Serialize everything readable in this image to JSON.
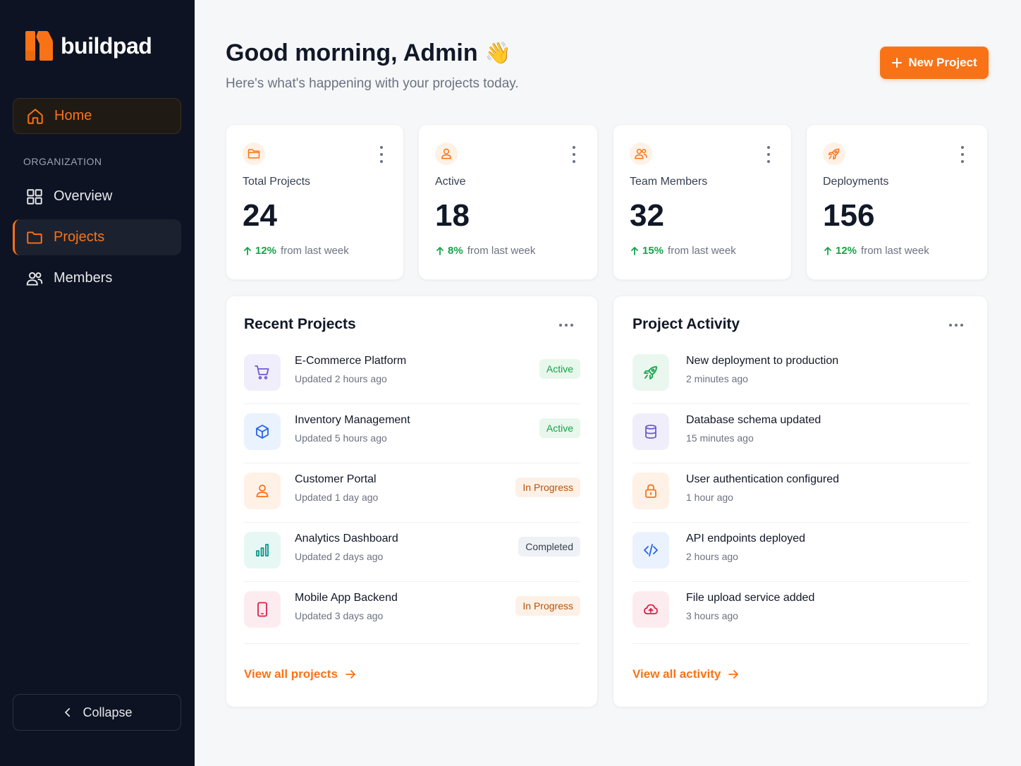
{
  "brand": {
    "name": "buildpad",
    "accent": "#f97316"
  },
  "sidebar": {
    "home_label": "Home",
    "section_label": "ORGANIZATION",
    "items": [
      {
        "label": "Overview",
        "icon": "grid-icon"
      },
      {
        "label": "Projects",
        "icon": "folder-icon"
      },
      {
        "label": "Members",
        "icon": "users-icon"
      }
    ],
    "collapse_label": "Collapse"
  },
  "header": {
    "greeting": "Good morning, Admin",
    "wave": "👋",
    "subtitle": "Here's what's happening with your projects today.",
    "new_project_label": "New Project"
  },
  "stats": [
    {
      "label": "Total Projects",
      "value": "24",
      "change": "12%",
      "change_text": "from last week",
      "icon": "folder-icon"
    },
    {
      "label": "Active",
      "value": "18",
      "change": "8%",
      "change_text": "from last week",
      "icon": "user-icon"
    },
    {
      "label": "Team Members",
      "value": "32",
      "change": "15%",
      "change_text": "from last week",
      "icon": "users-icon"
    },
    {
      "label": "Deployments",
      "value": "156",
      "change": "12%",
      "change_text": "from last week",
      "icon": "rocket-icon"
    }
  ],
  "recent_projects": {
    "title": "Recent Projects",
    "items": [
      {
        "name": "E-Commerce Platform",
        "updated": "Updated 2 hours ago",
        "status": "Active",
        "icon": "cart-icon",
        "icon_color": "#6d5bd0",
        "icon_bg": "#f1eefb"
      },
      {
        "name": "Inventory Management",
        "updated": "Updated 5 hours ago",
        "status": "Active",
        "icon": "box-icon",
        "icon_color": "#2563eb",
        "icon_bg": "#eaf2fd"
      },
      {
        "name": "Customer Portal",
        "updated": "Updated 1 day ago",
        "status": "In Progress",
        "icon": "user-icon",
        "icon_color": "#f97316",
        "icon_bg": "#fff1e6"
      },
      {
        "name": "Analytics Dashboard",
        "updated": "Updated 2 days ago",
        "status": "Completed",
        "icon": "bar-chart-icon",
        "icon_color": "#0d9488",
        "icon_bg": "#e6f7f4"
      },
      {
        "name": "Mobile App Backend",
        "updated": "Updated 3 days ago",
        "status": "In Progress",
        "icon": "phone-icon",
        "icon_color": "#e11d48",
        "icon_bg": "#fdecef"
      }
    ],
    "view_all": "View all projects"
  },
  "activity": {
    "title": "Project Activity",
    "items": [
      {
        "text": "New deployment to production",
        "time": "2 minutes ago",
        "icon": "rocket-icon",
        "icon_color": "#16a34a",
        "icon_bg": "#eaf7ee"
      },
      {
        "text": "Database schema updated",
        "time": "15 minutes ago",
        "icon": "database-icon",
        "icon_color": "#6d5bd0",
        "icon_bg": "#f1eefb"
      },
      {
        "text": "User authentication configured",
        "time": "1 hour ago",
        "icon": "lock-icon",
        "icon_color": "#f97316",
        "icon_bg": "#fff1e6"
      },
      {
        "text": "API endpoints deployed",
        "time": "2 hours ago",
        "icon": "code-icon",
        "icon_color": "#2563eb",
        "icon_bg": "#eaf2fd"
      },
      {
        "text": "File upload service added",
        "time": "3 hours ago",
        "icon": "cloud-upload-icon",
        "icon_color": "#e11d48",
        "icon_bg": "#fdecef"
      }
    ],
    "view_all": "View all activity"
  }
}
